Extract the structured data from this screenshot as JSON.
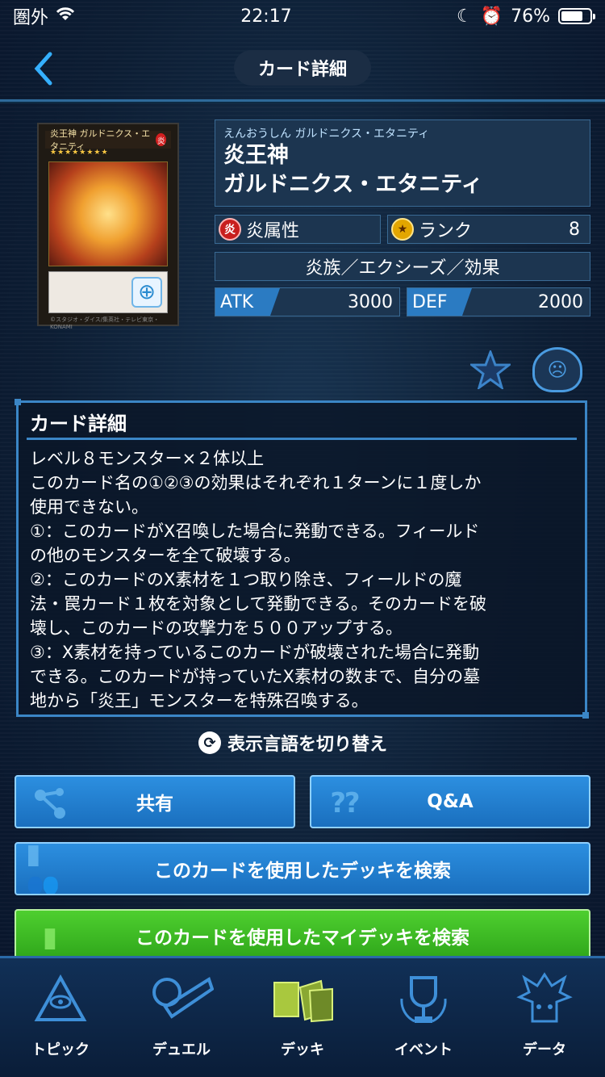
{
  "status_bar": {
    "carrier": "圏外",
    "time": "22:17",
    "battery_percent": "76%",
    "battery_level": 0.76
  },
  "header": {
    "title": "カード詳細",
    "back_icon": "chevron-left-icon"
  },
  "card": {
    "image_name": "炎王神 ガルドニクス・エタニティ",
    "image_attr": "炎",
    "image_stars": "★★★★★★★★",
    "image_copyright": "©スタジオ・ダイス/集英社・テレビ東京・KONAMI",
    "ruby": "えんおうしん ガルドニクス・エタニティ",
    "name_line1": "炎王神",
    "name_line2": "ガルドニクス・エタニティ",
    "attribute_badge": "炎",
    "attribute": "炎属性",
    "rank_label": "ランク",
    "rank": "8",
    "type": "炎族／エクシーズ／効果",
    "atk_label": "ATK",
    "atk": "3000",
    "def_label": "DEF",
    "def": "2000"
  },
  "description": {
    "title": "カード詳細",
    "lines": [
      "レベル８モンスター×２体以上",
      "このカード名の①②③の効果はそれぞれ１ターンに１度しか",
      "使用できない。",
      "①：このカードがX召喚した場合に発動できる。フィールド",
      "の他のモンスターを全て破壊する。",
      "②：このカードのX素材を１つ取り除き、フィールドの魔",
      "法・罠カード１枚を対象として発動できる。そのカードを破",
      "壊し、このカードの攻撃力を５００アップする。",
      "③：X素材を持っているこのカードが破壊された場合に発動",
      "できる。このカードが持っていたX素材の数まで、自分の墓",
      "地から「炎王」モンスターを特殊召喚する。"
    ]
  },
  "language_toggle": "表示言語を切り替え",
  "buttons": {
    "share": "共有",
    "qa": "Q&A",
    "search_deck": "このカードを使用したデッキを検索",
    "search_mydeck": "このカードを使用したマイデッキを検索"
  },
  "nav": [
    {
      "label": "トピック",
      "icon": "millennium-eye-icon"
    },
    {
      "label": "デュエル",
      "icon": "duel-disk-icon"
    },
    {
      "label": "デッキ",
      "icon": "deck-cards-icon"
    },
    {
      "label": "イベント",
      "icon": "trophy-icon"
    },
    {
      "label": "データ",
      "icon": "character-icon"
    }
  ],
  "colors": {
    "accent_blue": "#2c8fe0",
    "accent_green": "#4ecf2f",
    "fire_red": "#c81e1e",
    "background": "#0b1a2e"
  }
}
